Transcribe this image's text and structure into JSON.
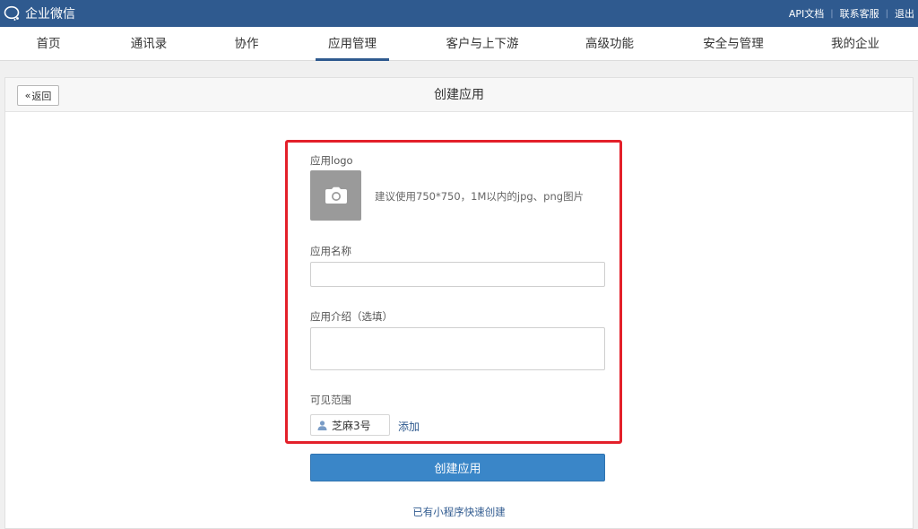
{
  "topbar": {
    "logo_text": "企业微信",
    "links": [
      "API文档",
      "联系客服",
      "退出"
    ]
  },
  "nav": {
    "items": [
      "首页",
      "通讯录",
      "协作",
      "应用管理",
      "客户与上下游",
      "高级功能",
      "安全与管理",
      "我的企业"
    ],
    "active": "应用管理"
  },
  "panel": {
    "back_label": "返回",
    "title": "创建应用"
  },
  "form": {
    "logo_label": "应用logo",
    "logo_hint": "建议使用750*750，1M以内的jpg、png图片",
    "name_label": "应用名称",
    "name_value": "",
    "desc_label": "应用介绍（选填）",
    "desc_value": "",
    "scope_label": "可见范围",
    "scope_member": "芝麻3号",
    "add_label": "添加",
    "create_label": "创建应用",
    "miniprogram_link": "已有小程序快速创建"
  },
  "colors": {
    "topbar": "#2f5a8f",
    "primary_button": "#3a86c8",
    "highlight_border": "#e3202a",
    "link": "#2f5a8f"
  }
}
